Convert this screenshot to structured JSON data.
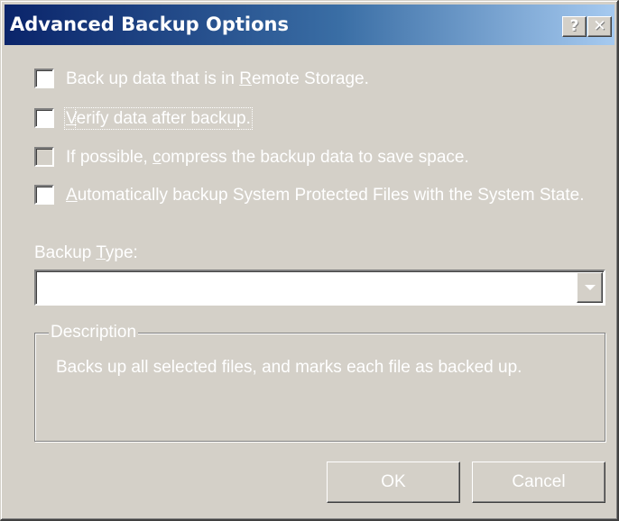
{
  "window": {
    "title": "Advanced Backup Options",
    "help_glyph": "?",
    "close_glyph": "✕"
  },
  "options": [
    {
      "label_pre": "Back up data that is in ",
      "accel": "R",
      "label_post": "emote Storage.",
      "checked": false,
      "enabled": true
    },
    {
      "label_pre": "",
      "accel": "V",
      "label_post": "erify data after backup.",
      "checked": false,
      "enabled": true,
      "focused": true
    },
    {
      "label_pre": "If possible, ",
      "accel": "c",
      "label_post": "ompress the backup data to save space.",
      "checked": false,
      "enabled": false
    },
    {
      "label_pre": "",
      "accel": "A",
      "label_post": "utomatically backup System Protected Files with the System State.",
      "checked": false,
      "enabled": true
    }
  ],
  "backup_type": {
    "label_pre": "Backup ",
    "accel": "T",
    "label_post": "ype:",
    "value": ""
  },
  "description": {
    "legend": "Description",
    "text": "Backs up all selected files, and marks each file as backed up."
  },
  "buttons": {
    "ok": "OK",
    "cancel": "Cancel"
  },
  "colors": {
    "face": "#d4d0c8",
    "title_gradient_start": "#0a246a",
    "title_gradient_end": "#a6caf0"
  }
}
